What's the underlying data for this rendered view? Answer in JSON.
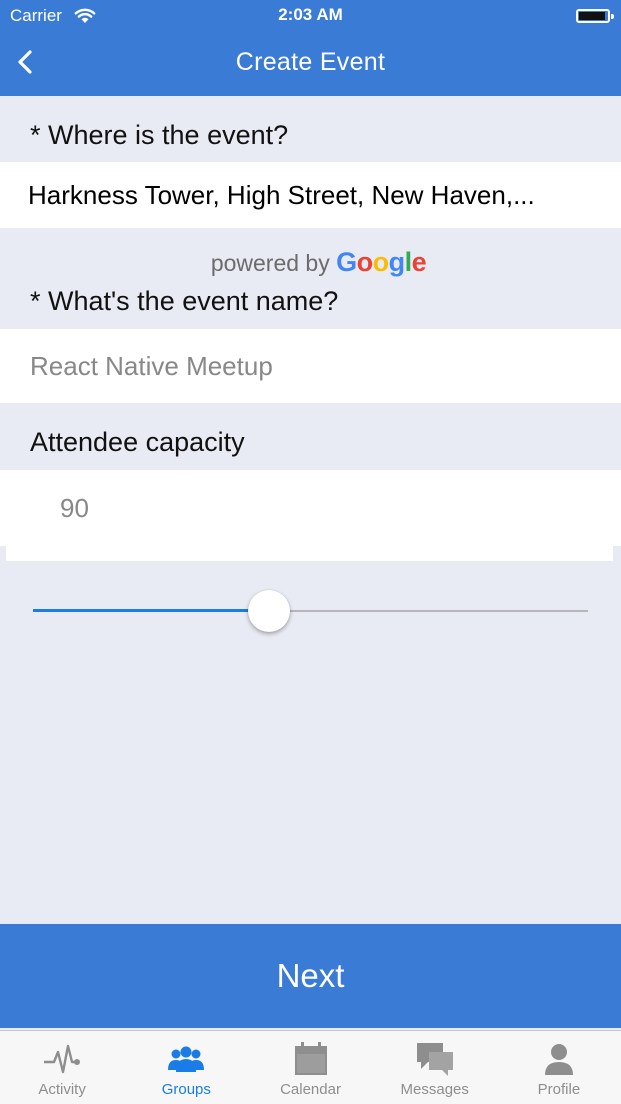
{
  "status_bar": {
    "carrier": "Carrier",
    "time": "2:03 AM"
  },
  "nav": {
    "title": "Create Event",
    "back_icon": "chevron-left-icon"
  },
  "form": {
    "location_label": "* Where is the event?",
    "location_value": "Harkness Tower, High Street, New Haven,...",
    "powered_by_prefix": "powered by",
    "powered_by_brand": [
      "G",
      "o",
      "o",
      "g",
      "l",
      "e"
    ],
    "name_label": "* What's the event name?",
    "name_placeholder": "React Native Meetup",
    "capacity_label": "Attendee capacity",
    "capacity_placeholder": "90",
    "capacity_slider_fraction": 0.42
  },
  "next_button": {
    "label": "Next"
  },
  "tabs": [
    {
      "label": "Activity",
      "icon": "activity-icon",
      "active": false
    },
    {
      "label": "Groups",
      "icon": "groups-icon",
      "active": true
    },
    {
      "label": "Calendar",
      "icon": "calendar-icon",
      "active": false
    },
    {
      "label": "Messages",
      "icon": "messages-icon",
      "active": false
    },
    {
      "label": "Profile",
      "icon": "profile-icon",
      "active": false
    }
  ],
  "colors": {
    "accent": "#3a7bd5",
    "active_tab": "#1a7ce6",
    "background": "#e8ebf3",
    "google_blue": "#4285F4",
    "google_red": "#EA4335",
    "google_yellow": "#FBBC05",
    "google_green": "#34A853"
  }
}
